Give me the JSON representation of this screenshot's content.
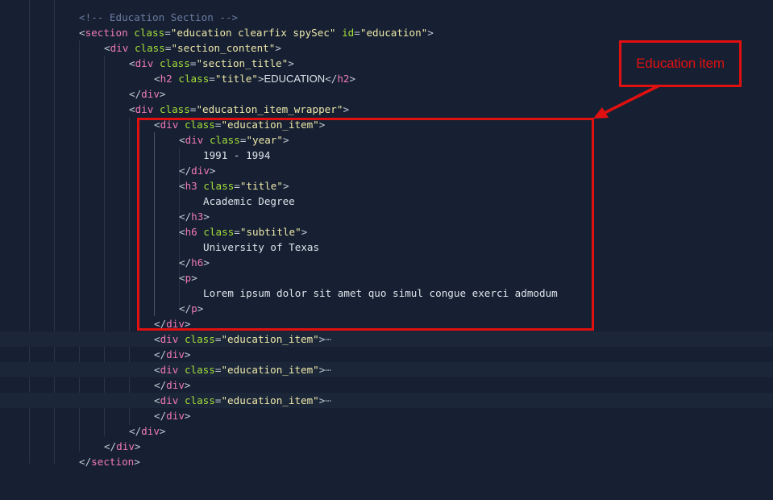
{
  "code": {
    "comment": "<!-- Education Section -->",
    "section_tag": "section",
    "div_tag": "div",
    "h2_tag": "h2",
    "h3_tag": "h3",
    "h6_tag": "h6",
    "p_tag": "p",
    "attr_class": "class",
    "attr_id": "id",
    "section_class": "\"education clearfix spySec\"",
    "section_id": "\"education\"",
    "section_content": "\"section_content\"",
    "section_title": "\"section_title\"",
    "title_class": "\"title\"",
    "heading_text": "EDUCATION",
    "wrapper_class": "\"education_item_wrapper\"",
    "item_class": "\"education_item\"",
    "year_class": "\"year\"",
    "year_text": "1991 - 1994",
    "degree_text": "Academic Degree",
    "subtitle_class": "\"subtitle\"",
    "university_text": "University of Texas",
    "lorem_text": "Lorem ipsum dolor sit amet quo simul congue exerci admodum",
    "ellipsis": "⋯"
  },
  "annotation": {
    "label": "Education item",
    "color": "#e01010"
  },
  "colors": {
    "background": "#162032",
    "tag": "#f07ab5",
    "attribute": "#a3dd3a",
    "string": "#eee8aa",
    "comment": "#6a7aa0"
  }
}
